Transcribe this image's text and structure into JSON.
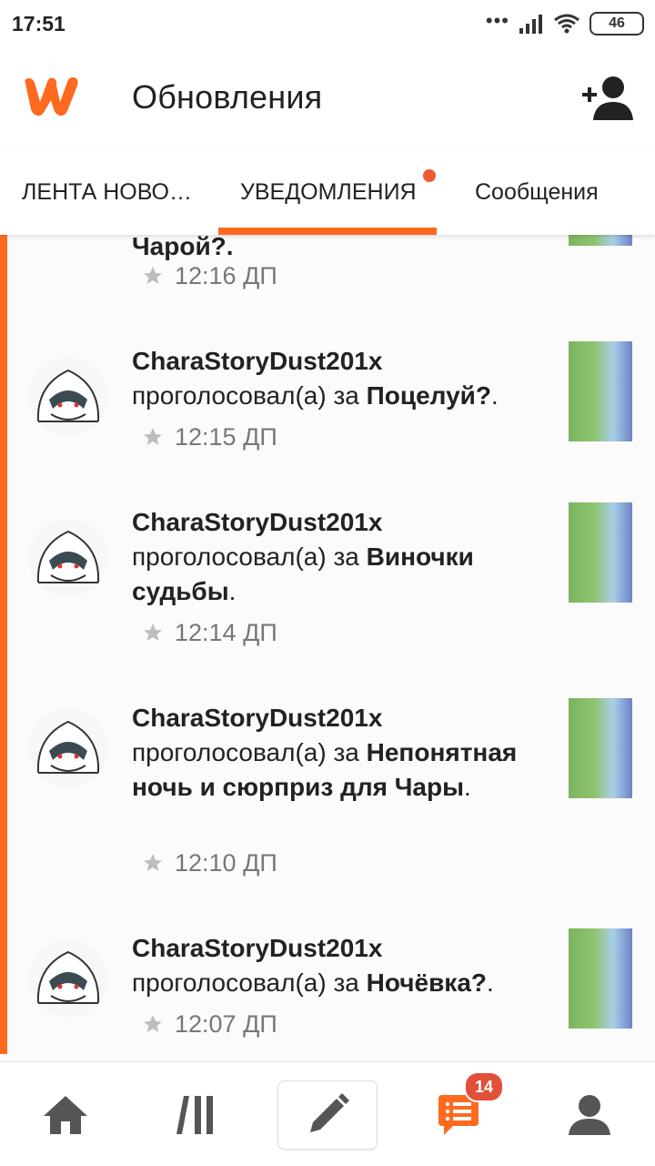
{
  "status_bar": {
    "time": "17:51",
    "battery": "46",
    "signal_dots": "•••"
  },
  "header": {
    "title": "Обновления"
  },
  "tabs": [
    {
      "label": "ЛЕНТА НОВОСТЕЙ"
    },
    {
      "label": "УВЕДОМЛЕНИЯ"
    },
    {
      "label": "Сообщения"
    }
  ],
  "feed": {
    "partial_row": {
      "story_fragment": "Чарой?.",
      "time": "12:16 ДП"
    },
    "items": [
      {
        "author": "CharaStoryDust201x",
        "action": "проголосовал(а) за",
        "story": "Поцелуй?",
        "suffix": ".",
        "time": "12:15 ДП"
      },
      {
        "author": "CharaStoryDust201x",
        "action": "проголосовал(а) за",
        "story": "Виночки судьбы",
        "suffix": ".",
        "time": "12:14 ДП"
      },
      {
        "author": "CharaStoryDust201x",
        "action": "проголосовал(а) за",
        "story": "Непонятная ночь и сюрприз для Чары",
        "suffix": ".",
        "time": "12:10 ДП"
      },
      {
        "author": "CharaStoryDust201x",
        "action": "проголосовал(а) за",
        "story": "Ночёвка?",
        "suffix": ".",
        "time": "12:07 ДП"
      }
    ]
  },
  "bottom_nav": {
    "messages_badge": "14"
  },
  "colors": {
    "accent": "#ff6a1f",
    "badge": "#e2503a",
    "muted_text": "#777777"
  },
  "icons": [
    "wattpad-logo-icon",
    "add-friend-icon",
    "star-icon",
    "home-icon",
    "library-icon",
    "pencil-icon",
    "messages-icon",
    "profile-icon"
  ]
}
